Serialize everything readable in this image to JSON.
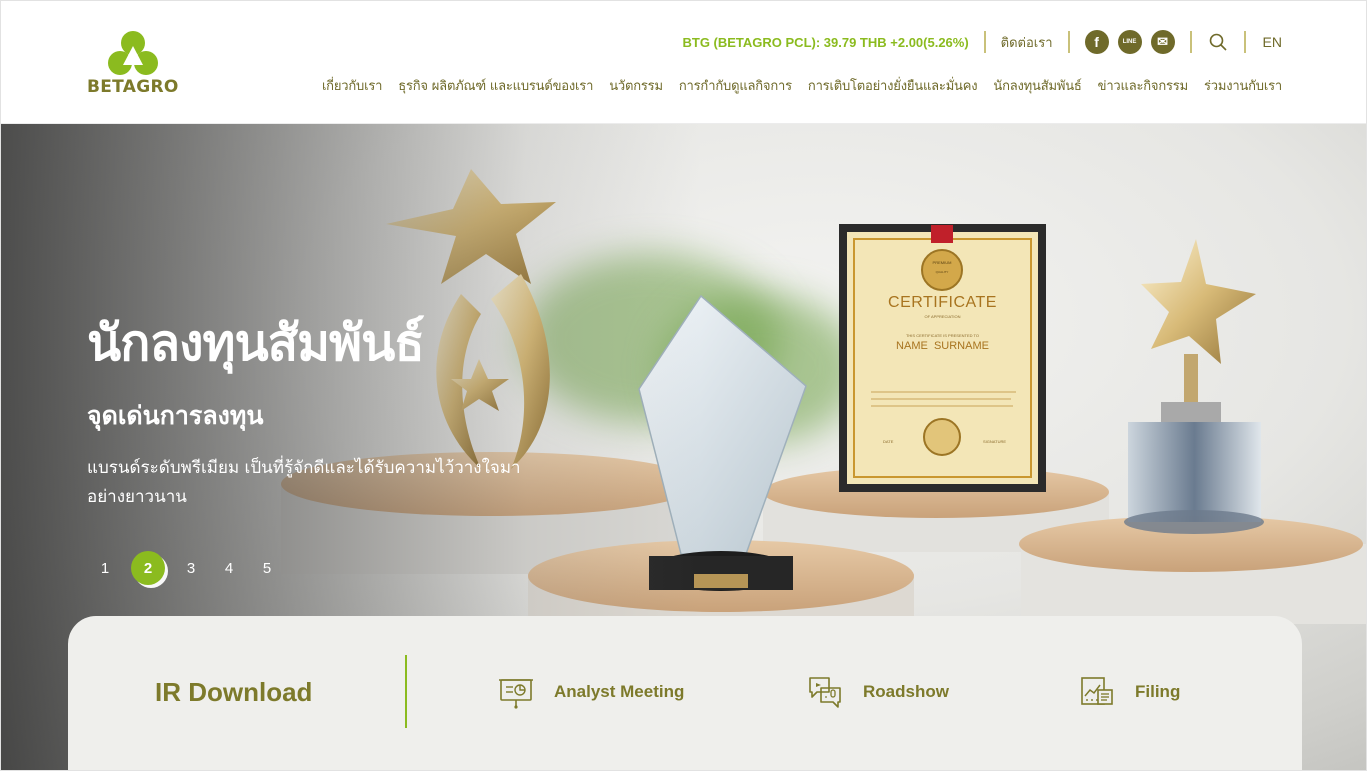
{
  "brand": {
    "name": "BETAGRO"
  },
  "topbar": {
    "stock": "BTG (BETAGRO PCL): 39.79 THB +2.00(5.26%)",
    "contact": "ติดต่อเรา",
    "social": [
      {
        "icon": "facebook-icon",
        "glyph": "f"
      },
      {
        "icon": "line-icon",
        "glyph": "LINE"
      },
      {
        "icon": "email-icon",
        "glyph": "✉"
      }
    ],
    "search_icon": "search-icon",
    "lang": "EN"
  },
  "nav": [
    "เกี่ยวกับเรา",
    "ธุรกิจ ผลิตภัณฑ์ และแบรนด์ของเรา",
    "นวัตกรรม",
    "การกำกับดูแลกิจการ",
    "การเติบโตอย่างยั่งยืนและมั่นคง",
    "นักลงทุนสัมพันธ์",
    "ข่าวและกิจกรรม",
    "ร่วมงานกับเรา"
  ],
  "hero": {
    "title": "นักลงทุนสัมพันธ์",
    "subtitle": "จุดเด่นการลงทุน",
    "description": "แบรนด์ระดับพรีเมียม เป็นที่รู้จักดีและได้รับความไว้วางใจมาอย่างยาวนาน",
    "certificate": {
      "heading": "CERTIFICATE",
      "sub": "OF APPRECIATION",
      "presented": "THIS CERTIFICATE IS PRESENTED TO",
      "name": "NAME  SURNAME",
      "date": "DATE",
      "signature": "SIGNATURE",
      "badge_top": "PREMIUM",
      "badge_bottom": "QUALITY"
    },
    "pagination": {
      "pages": [
        "1",
        "2",
        "3",
        "4",
        "5"
      ],
      "active": "2"
    }
  },
  "ir_download": {
    "title": "IR Download",
    "items": [
      {
        "label": "Analyst Meeting",
        "icon": "presentation-icon"
      },
      {
        "label": "Roadshow",
        "icon": "chat-bubbles-icon"
      },
      {
        "label": "Filing",
        "icon": "document-chart-icon"
      }
    ]
  },
  "colors": {
    "brand_olive": "#7d7a2b",
    "brand_green": "#8bbb1f",
    "nav_text": "#6f6a2a",
    "panel_bg": "#efefec"
  }
}
